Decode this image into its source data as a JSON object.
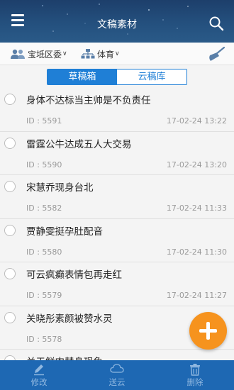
{
  "header": {
    "title": "文稿素材",
    "icons": {
      "menu": "menu-icon",
      "search": "search-icon"
    }
  },
  "filters": {
    "department": {
      "label": "宝坻区委",
      "icon": "people-icon"
    },
    "category": {
      "label": "体育",
      "icon": "org-chart-icon"
    },
    "clear_icon": "broom-icon"
  },
  "tabs": [
    {
      "label": "草稿箱",
      "active": true
    },
    {
      "label": "云稿库",
      "active": false
    }
  ],
  "items": [
    {
      "title": "身体不达标当主帅是不负责任",
      "id": "ID : 5591",
      "date": "17-02-24 13:22"
    },
    {
      "title": "雷霆公牛达成五人大交易",
      "id": "ID : 5590",
      "date": "17-02-24 13:20"
    },
    {
      "title": "宋慧乔现身台北",
      "id": "ID : 5582",
      "date": "17-02-24 11:33"
    },
    {
      "title": "贾静雯挺孕肚配音",
      "id": "ID : 5580",
      "date": "17-02-24 11:30"
    },
    {
      "title": "可云疯癫表情包再走红",
      "id": "ID : 5579",
      "date": "17-02-24 11:27"
    },
    {
      "title": "关晓彤素颜被赞水灵",
      "id": "ID : 5578",
      "date": ""
    },
    {
      "title": "关于鲜肉替身现象",
      "id": "",
      "date": ""
    }
  ],
  "fab": {
    "icon": "plus-icon",
    "color": "#f6931e"
  },
  "bottom_bar": [
    {
      "label": "修改",
      "icon": "pencil-icon"
    },
    {
      "label": "送云",
      "icon": "cloud-icon"
    },
    {
      "label": "删除",
      "icon": "trash-icon"
    }
  ],
  "colors": {
    "accent": "#1f7fd6",
    "bottom_bar": "#1e68b3",
    "header": "#24507e"
  }
}
